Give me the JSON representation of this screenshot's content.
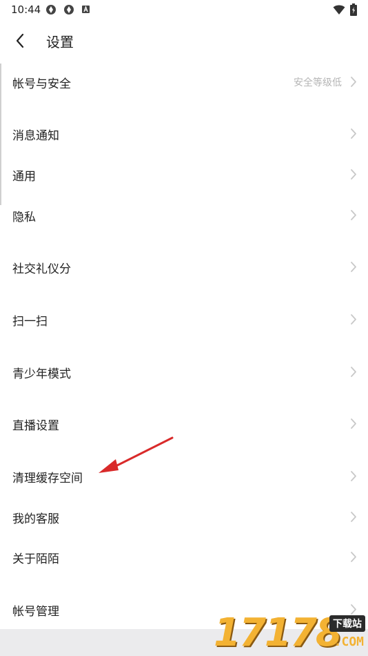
{
  "status_bar": {
    "time": "10:44"
  },
  "header": {
    "title": "设置"
  },
  "rows": [
    {
      "label": "帐号与安全",
      "value": "安全等级低"
    },
    {
      "label": "消息通知",
      "value": ""
    },
    {
      "label": "通用",
      "value": ""
    },
    {
      "label": "隐私",
      "value": ""
    },
    {
      "label": "社交礼仪分",
      "value": ""
    },
    {
      "label": "扫一扫",
      "value": ""
    },
    {
      "label": "青少年模式",
      "value": ""
    },
    {
      "label": "直播设置",
      "value": ""
    },
    {
      "label": "清理缓存空间",
      "value": ""
    },
    {
      "label": "我的客服",
      "value": ""
    },
    {
      "label": "关于陌陌",
      "value": ""
    },
    {
      "label": "帐号管理",
      "value": ""
    }
  ],
  "watermark": {
    "digits": "17178",
    "badge": "下载站",
    "suffix": ".COM"
  },
  "colors": {
    "annotation_arrow": "#d92a2a",
    "secondary_text": "#b5b5b5",
    "chevron": "#c8c8c8",
    "bottom_band": "#ebebed"
  }
}
